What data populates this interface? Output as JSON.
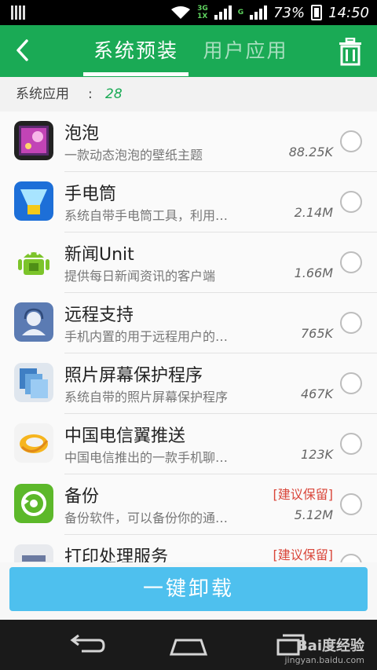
{
  "status_bar": {
    "network": [
      "3G",
      "1X"
    ],
    "network2": "G",
    "battery": "73%",
    "time": "14:50"
  },
  "header": {
    "tabs": [
      "系统预装",
      "用户应用"
    ],
    "active_tab": 0
  },
  "section": {
    "label": "系统应用",
    "colon": ":",
    "count": "28"
  },
  "apps": [
    {
      "name": "泡泡",
      "desc": "一款动态泡泡的壁纸主题",
      "size": "88.25K",
      "tag": ""
    },
    {
      "name": "手电筒",
      "desc": "系统自带手电筒工具，利用…",
      "size": "2.14M",
      "tag": ""
    },
    {
      "name": "新闻Unit",
      "desc": "提供每日新闻资讯的客户端",
      "size": "1.66M",
      "tag": ""
    },
    {
      "name": "远程支持",
      "desc": "手机内置的用于远程用户的…",
      "size": "765K",
      "tag": ""
    },
    {
      "name": "照片屏幕保护程序",
      "desc": "系统自带的照片屏幕保护程序",
      "size": "467K",
      "tag": ""
    },
    {
      "name": "中国电信翼推送",
      "desc": "中国电信推出的一款手机聊…",
      "size": "123K",
      "tag": ""
    },
    {
      "name": "备份",
      "desc": "备份软件，可以备份你的通…",
      "size": "5.12M",
      "tag": "[建议保留]"
    },
    {
      "name": "打印处理服务",
      "desc": "",
      "size": "",
      "tag": "[建议保留]"
    }
  ],
  "actions": {
    "uninstall_label": "一键卸载"
  },
  "watermark": {
    "brand": "Bai度经验",
    "url": "jingyan.baidu.com"
  },
  "colors": {
    "header": "#1aaa55",
    "button": "#4ec0ee",
    "tag": "#d9463a"
  }
}
